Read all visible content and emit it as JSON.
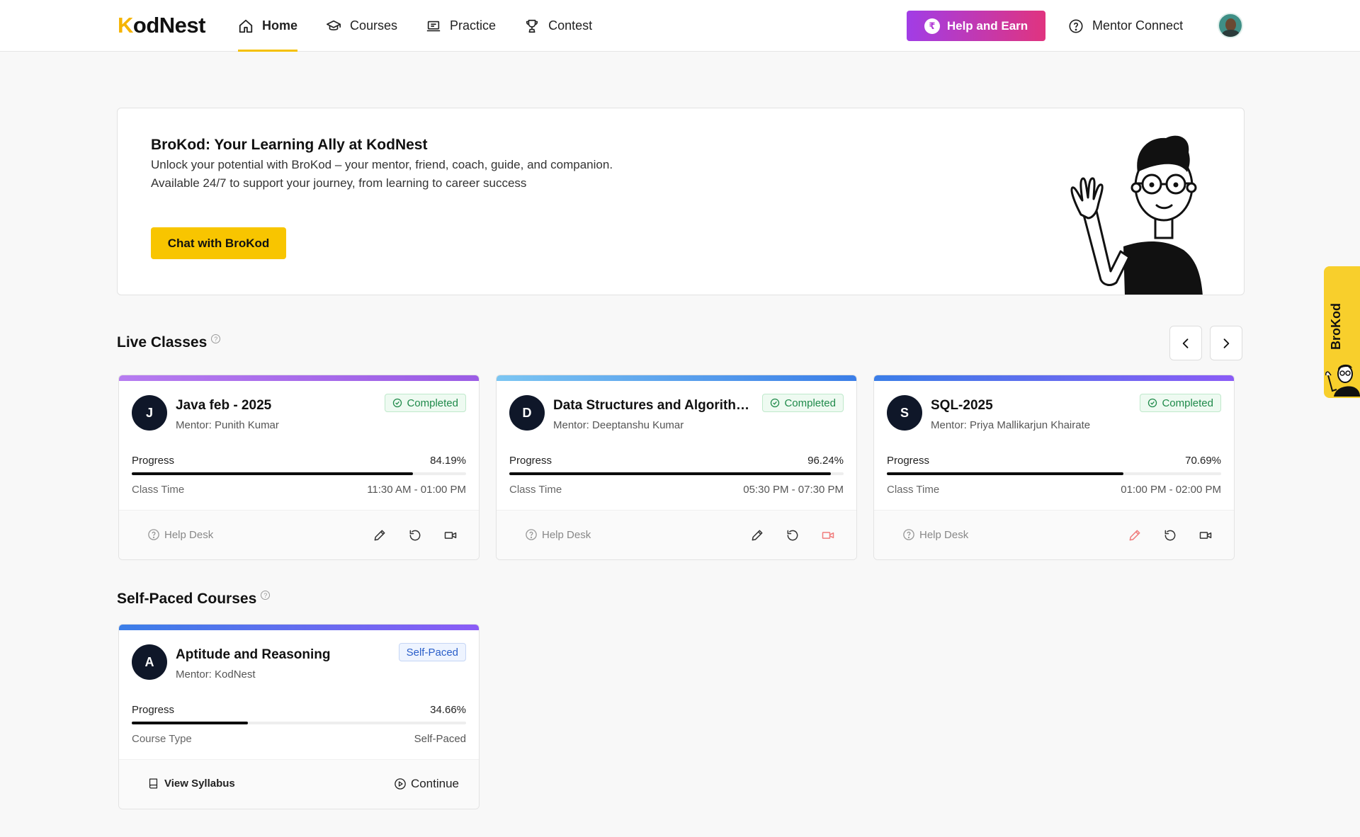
{
  "header": {
    "logo_k": "K",
    "logo_rest": "odNest",
    "nav": [
      {
        "label": "Home",
        "icon": "home-icon",
        "active": true
      },
      {
        "label": "Courses",
        "icon": "graduation-cap-icon"
      },
      {
        "label": "Practice",
        "icon": "laptop-icon"
      },
      {
        "label": "Contest",
        "icon": "trophy-icon"
      }
    ],
    "help_earn": "Help and Earn",
    "rupee": "₹",
    "mentor_connect": "Mentor Connect"
  },
  "banner": {
    "title": "BroKod: Your Learning Ally at KodNest",
    "line1": "Unlock your potential with BroKod – your mentor, friend, coach, guide, and companion.",
    "line2": "Available 24/7 to support your journey, from learning to career success",
    "button": "Chat with BroKod"
  },
  "live_classes": {
    "title": "Live Classes",
    "cards": [
      {
        "initial": "J",
        "title": "Java feb - 2025",
        "mentor": "Mentor: Punith Kumar",
        "status": "Completed",
        "progress_label": "Progress",
        "progress": "84.19%",
        "progress_value": 84.19,
        "meta_label": "Class Time",
        "meta_value": "11:30 AM - 01:00 PM",
        "help": "Help Desk",
        "accent_from": "#b67cf0",
        "accent_to": "#9b5de5"
      },
      {
        "initial": "D",
        "title": "Data Structures and Algorithms",
        "mentor": "Mentor: Deeptanshu Kumar",
        "status": "Completed",
        "progress_label": "Progress",
        "progress": "96.24%",
        "progress_value": 96.24,
        "meta_label": "Class Time",
        "meta_value": "05:30 PM - 07:30 PM",
        "help": "Help Desk",
        "accent_from": "#7cc6f2",
        "accent_to": "#3b7ee8"
      },
      {
        "initial": "S",
        "title": "SQL-2025",
        "mentor": "Mentor: Priya Mallikarjun Khairate",
        "status": "Completed",
        "progress_label": "Progress",
        "progress": "70.69%",
        "progress_value": 70.69,
        "meta_label": "Class Time",
        "meta_value": "01:00 PM - 02:00 PM",
        "help": "Help Desk",
        "accent_from": "#3b7ee8",
        "accent_to": "#8b5cf6"
      }
    ]
  },
  "self_paced": {
    "title": "Self-Paced Courses",
    "card": {
      "initial": "A",
      "title": "Aptitude and Reasoning",
      "mentor": "Mentor: KodNest",
      "status": "Self-Paced",
      "progress_label": "Progress",
      "progress": "34.66%",
      "progress_value": 34.66,
      "meta_label": "Course Type",
      "meta_value": "Self-Paced",
      "syllabus": "View Syllabus",
      "continue": "Continue"
    }
  },
  "side_tab": "BroKod",
  "colors": {
    "brand_yellow": "#f8c500",
    "success": "#1f8a4a",
    "danger_icon": "#f07c7c"
  }
}
